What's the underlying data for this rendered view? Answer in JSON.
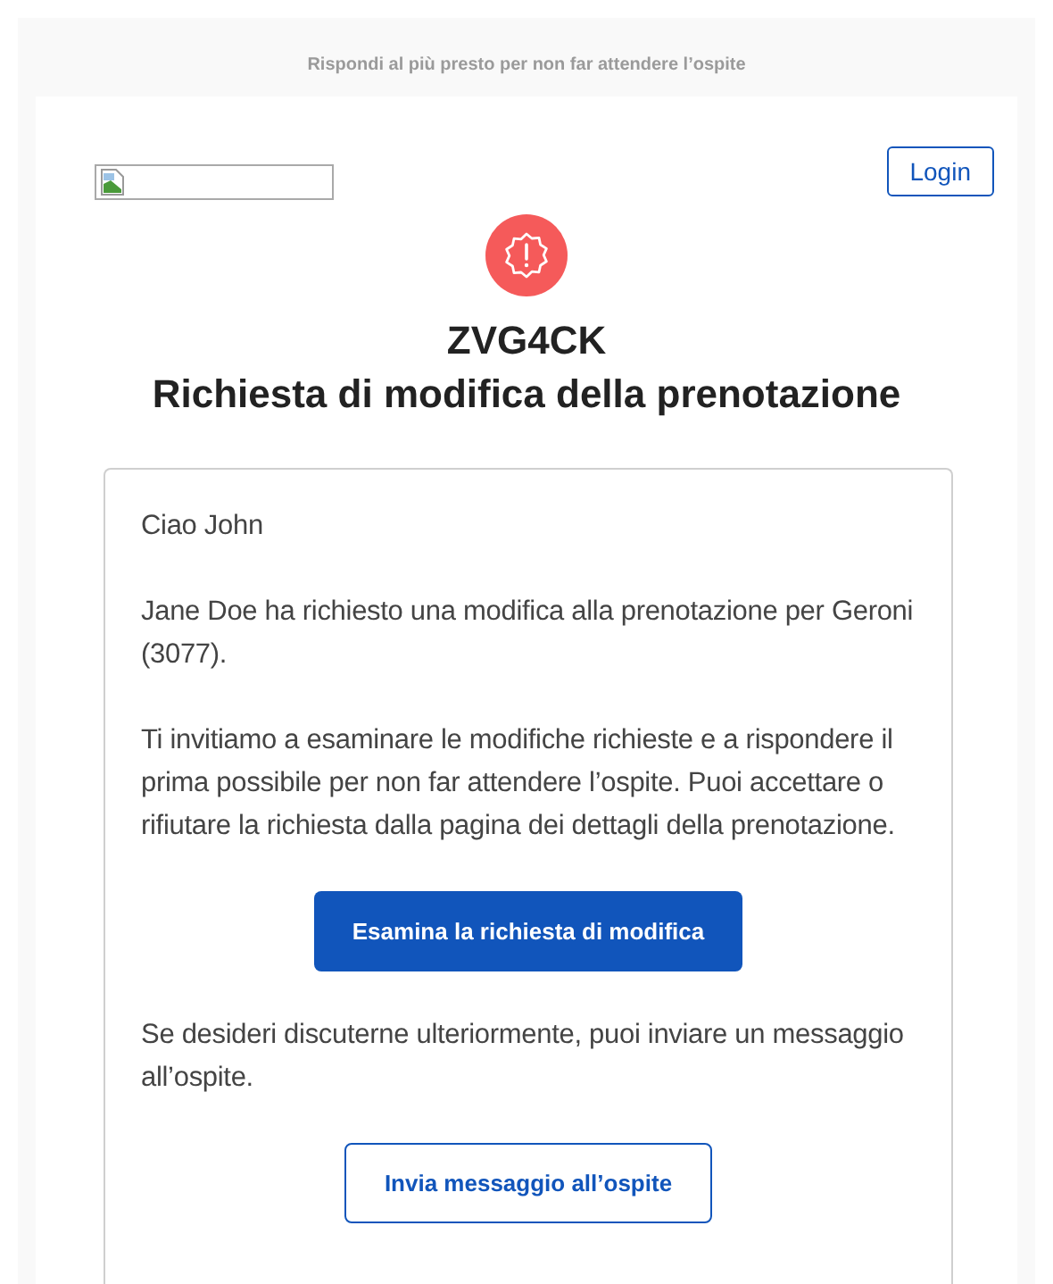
{
  "preheader": "Rispondi al più presto per non far attendere l’ospite",
  "header": {
    "login_button": "Login"
  },
  "code": "ZVG4CK",
  "title": "Richiesta di modifica della prenotazione",
  "body": {
    "greeting": "Ciao John",
    "paragraphs": [
      "Jane Doe ha richiesto una modifica alla prenotazione per Geroni (3077).",
      "Ti invitiamo a esaminare le modifiche richieste e a rispondere il prima possibile per non far attendere l’ospite. Puoi accettare o rifiutare la richiesta dalla pagina dei dettagli della prenotazione."
    ],
    "primary_button": "Esamina la richiesta di modifica",
    "secondary_text": "Se desideri discuterne ulteriormente, puoi inviare un messaggio all’ospite.",
    "secondary_button": "Invia messaggio all’ospite"
  }
}
